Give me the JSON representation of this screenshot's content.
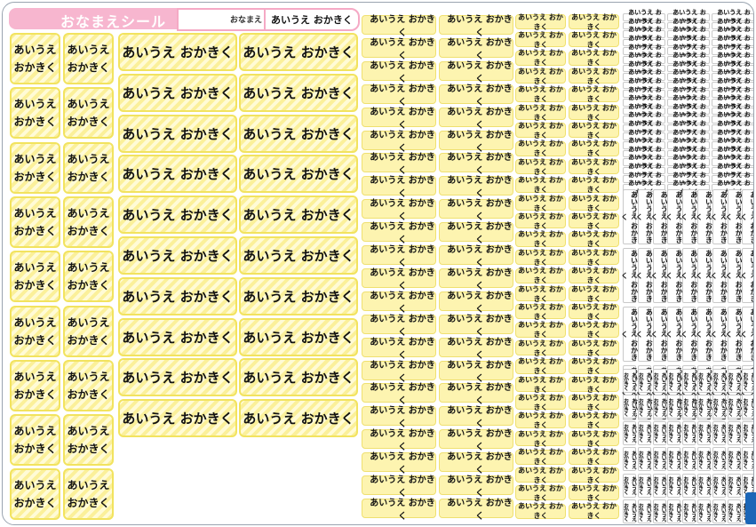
{
  "header": {
    "title": "おなまえシール",
    "name_label": "おなまえ",
    "name_value": "あいうえ おかきく"
  },
  "label_text": "あいうえ おかきく",
  "label_line1": "あいうえ",
  "label_line2": "おかきく",
  "colors": {
    "header_pink": "#f7b6cf",
    "label_yellow": "#fdf4b0",
    "label_border": "#f2e35f",
    "corner_tab_blue": "#1b66b7"
  },
  "labels": {
    "square_two_line": 18,
    "large_striped": 20,
    "medium": 44,
    "small": 56,
    "tiny": 84,
    "vertical_medium": 36,
    "vertical_tiny": 52
  }
}
